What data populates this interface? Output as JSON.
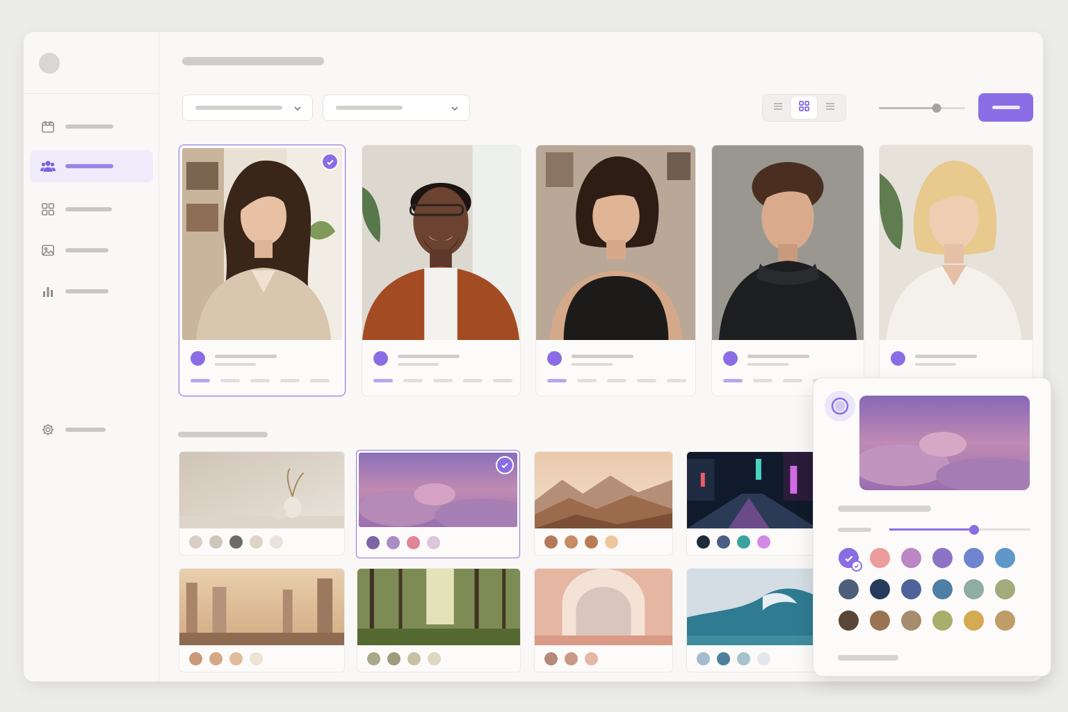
{
  "sidebar": {
    "items": [
      {
        "name": "calendar-icon",
        "active": false
      },
      {
        "name": "users-icon",
        "active": true
      },
      {
        "name": "grid-icon",
        "active": false
      },
      {
        "name": "image-icon",
        "active": false
      },
      {
        "name": "bar-chart-icon",
        "active": false
      }
    ],
    "settings": {
      "name": "gear-icon"
    }
  },
  "toolbar": {
    "view_modes": [
      "list-icon",
      "grid-icon",
      "details-icon"
    ],
    "active_view": "grid-icon",
    "size_slider_level": 0.67
  },
  "avatars": [
    {
      "selected": true
    },
    {
      "selected": false
    },
    {
      "selected": false
    },
    {
      "selected": false
    },
    {
      "selected": false
    }
  ],
  "backgrounds": [
    {
      "scene": "minimal-interior",
      "selected": false,
      "palette": [
        "#d9cfc4",
        "#cfc6bb",
        "#6e6a66",
        "#dcd4c9",
        "#e8e3dc"
      ]
    },
    {
      "scene": "purple-clouds",
      "selected": true,
      "palette": [
        "#7b65a6",
        "#a98cc4",
        "#e0849a",
        "#dcc6da"
      ]
    },
    {
      "scene": "desert-mountains",
      "selected": false,
      "palette": [
        "#b5785a",
        "#c58c66",
        "#b87c55",
        "#efc79e"
      ]
    },
    {
      "scene": "neon-city-street",
      "selected": false,
      "palette": [
        "#1c2b38",
        "#4b5f86",
        "#3aa3a0",
        "#d38ae6"
      ]
    },
    {
      "scene": "golden-skyline",
      "selected": false,
      "palette": [
        "#c9997a",
        "#d4a886",
        "#e0bc9a",
        "#eee3d4"
      ]
    },
    {
      "scene": "sunlit-forest",
      "selected": false,
      "palette": [
        "#a8a88a",
        "#9d9c7c",
        "#c6c1a2",
        "#ddd8c0"
      ]
    },
    {
      "scene": "pink-arch",
      "selected": false,
      "palette": [
        "#b48a7a",
        "#c99888",
        "#e6b8a6"
      ]
    },
    {
      "scene": "ocean-wave",
      "selected": false,
      "palette": [
        "#a3bcd0",
        "#4e7f9c",
        "#a7c2cf",
        "#e3e8ec"
      ]
    }
  ],
  "picker": {
    "opacity_level": 0.6,
    "colors": [
      "#8a6de4",
      "#eb9c9c",
      "#bd86c4",
      "#8c74c4",
      "#6e84cf",
      "#5f97c8",
      "#4e5f7b",
      "#263a5c",
      "#4f629a",
      "#4f7fa5",
      "#8fada4",
      "#a2ab7b",
      "#5a4637",
      "#9a7352",
      "#a68d6d",
      "#a6b06c",
      "#d4aa52",
      "#c09c68"
    ],
    "selected_index": 0
  }
}
